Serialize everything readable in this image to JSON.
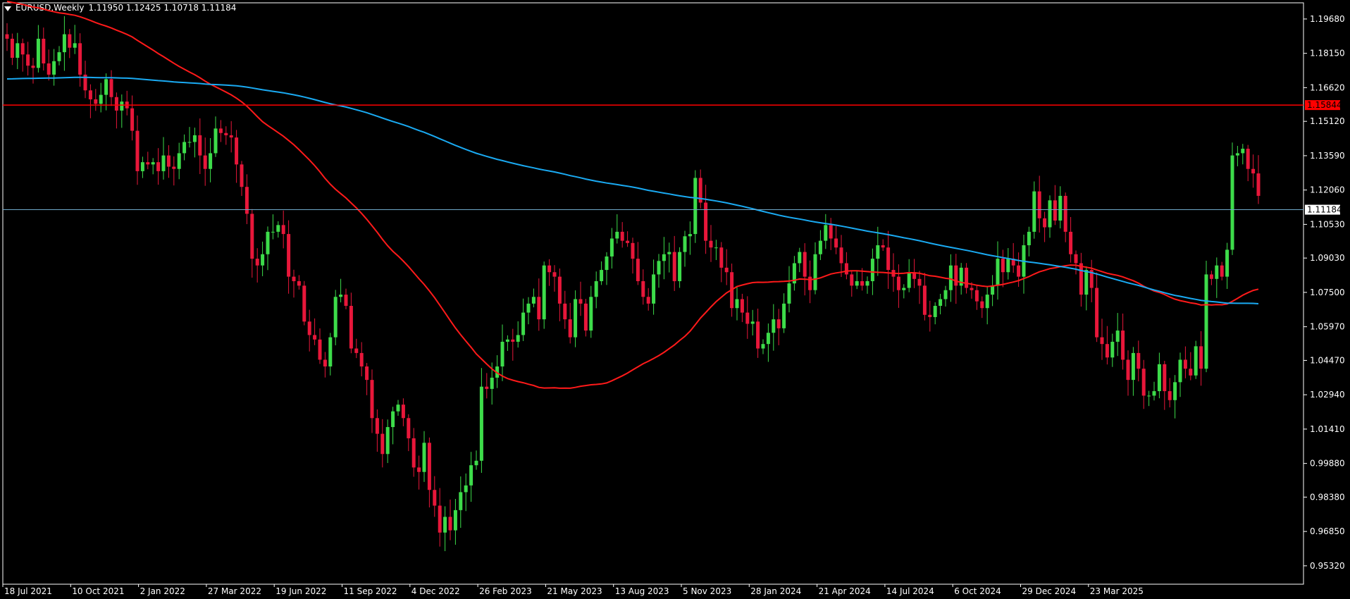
{
  "header": {
    "symbol_line": "EURUSD,Weekly",
    "ohlc": "1.11950 1.12425 1.10718 1.11184"
  },
  "colors": {
    "background": "#000000",
    "grid": "none",
    "bull": "#3ddc4a",
    "bear": "#e8173a",
    "ma_fast": "#ff1a1a",
    "ma_slow": "#1aaaf2",
    "level_line": "#ff0000",
    "price_line": "#6fa8c8",
    "axis": "#ffffff"
  },
  "chart_data": {
    "type": "candlestick",
    "timeframe": "Weekly",
    "ylim": [
      0.945,
      1.204
    ],
    "y_ticks": [
      "1.19680",
      "1.18150",
      "1.16620",
      "1.15120",
      "1.13590",
      "1.12060",
      "1.10530",
      "1.09030",
      "1.07500",
      "1.05970",
      "1.04470",
      "1.02940",
      "1.01410",
      "0.99880",
      "0.98380",
      "0.96850",
      "0.95320"
    ],
    "x_ticks": [
      "18 Jul 2021",
      "10 Oct 2021",
      "2 Jan 2022",
      "27 Mar 2022",
      "19 Jun 2022",
      "11 Sep 2022",
      "4 Dec 2022",
      "26 Feb 2023",
      "21 May 2023",
      "13 Aug 2023",
      "5 Nov 2023",
      "28 Jan 2024",
      "21 Apr 2024",
      "14 Jul 2024",
      "6 Oct 2024",
      "29 Dec 2024",
      "23 Mar 2025"
    ],
    "closes": [
      1.188,
      1.1795,
      1.186,
      1.181,
      1.176,
      1.175,
      1.188,
      1.177,
      1.172,
      1.178,
      1.182,
      1.19,
      1.184,
      1.186,
      1.172,
      1.165,
      1.161,
      1.159,
      1.163,
      1.17,
      1.162,
      1.156,
      1.16,
      1.157,
      1.147,
      1.129,
      1.133,
      1.132,
      1.133,
      1.129,
      1.136,
      1.131,
      1.13,
      1.137,
      1.142,
      1.142,
      1.145,
      1.136,
      1.13,
      1.137,
      1.148,
      1.146,
      1.145,
      1.144,
      1.132,
      1.122,
      1.11,
      1.09,
      1.087,
      1.092,
      1.102,
      1.102,
      1.105,
      1.101,
      1.082,
      1.08,
      1.078,
      1.062,
      1.056,
      1.054,
      1.045,
      1.042,
      1.055,
      1.073,
      1.074,
      1.069,
      1.05,
      1.048,
      1.042,
      1.036,
      1.019,
      1.012,
      1.003,
      1.015,
      1.022,
      1.025,
      1.019,
      1.01,
      0.997,
      0.995,
      1.008,
      0.987,
      0.98,
      0.968,
      0.975,
      0.969,
      0.978,
      0.986,
      0.989,
      0.998,
      1.0,
      1.033,
      1.032,
      1.037,
      1.042,
      1.053,
      1.054,
      1.053,
      1.056,
      1.066,
      1.07,
      1.073,
      1.063,
      1.087,
      1.084,
      1.082,
      1.07,
      1.063,
      1.055,
      1.072,
      1.07,
      1.058,
      1.073,
      1.08,
      1.085,
      1.091,
      1.099,
      1.102,
      1.098,
      1.097,
      1.09,
      1.08,
      1.073,
      1.07,
      1.083,
      1.089,
      1.092,
      1.093,
      1.08,
      1.093,
      1.1,
      1.101,
      1.126,
      1.115,
      1.098,
      1.095,
      1.095,
      1.086,
      1.084,
      1.068,
      1.072,
      1.066,
      1.061,
      1.062,
      1.05,
      1.052,
      1.057,
      1.063,
      1.059,
      1.07,
      1.079,
      1.088,
      1.093,
      1.082,
      1.076,
      1.092,
      1.098,
      1.105,
      1.099,
      1.095,
      1.088,
      1.083,
      1.078,
      1.08,
      1.078,
      1.08,
      1.09,
      1.096,
      1.095,
      1.085,
      1.082,
      1.076,
      1.077,
      1.084,
      1.081,
      1.078,
      1.065,
      1.064,
      1.069,
      1.072,
      1.076,
      1.087,
      1.078,
      1.086,
      1.077,
      1.076,
      1.071,
      1.068,
      1.074,
      1.078,
      1.09,
      1.084,
      1.09,
      1.087,
      1.082,
      1.096,
      1.102,
      1.12,
      1.108,
      1.104,
      1.116,
      1.107,
      1.118,
      1.102,
      1.092,
      1.088,
      1.074,
      1.085,
      1.077,
      1.055,
      1.052,
      1.046,
      1.053,
      1.058,
      1.045,
      1.036,
      1.048,
      1.041,
      1.029,
      1.029,
      1.031,
      1.043,
      1.031,
      1.027,
      1.035,
      1.045,
      1.041,
      1.038,
      1.051,
      1.041,
      1.083,
      1.081,
      1.087,
      1.082,
      1.094,
      1.136,
      1.137,
      1.139,
      1.13,
      1.128,
      1.118
    ]
  }
}
